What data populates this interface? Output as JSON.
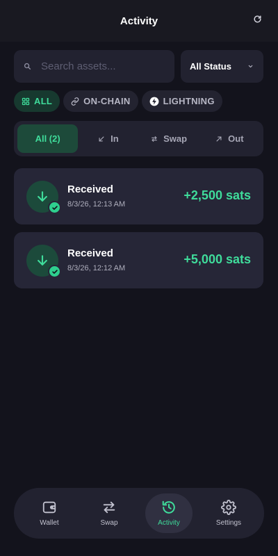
{
  "header": {
    "title": "Activity",
    "refresh_icon": "refresh-icon"
  },
  "search": {
    "placeholder": "Search assets...",
    "value": ""
  },
  "status_filter": {
    "selected": "All Status"
  },
  "network_filters": [
    {
      "label": "ALL",
      "icon": "grid-icon",
      "active": true
    },
    {
      "label": "ON-CHAIN",
      "icon": "link-icon",
      "active": false
    },
    {
      "label": "LIGHTNING",
      "icon": "lightning-icon",
      "active": false
    }
  ],
  "direction_tabs": [
    {
      "label": "All (2)",
      "active": true
    },
    {
      "label": "In",
      "icon": "arrow-down-left-icon",
      "active": false
    },
    {
      "label": "Swap",
      "icon": "swap-icon",
      "active": false
    },
    {
      "label": "Out",
      "icon": "arrow-up-right-icon",
      "active": false
    }
  ],
  "transactions": [
    {
      "title": "Received",
      "date": "8/3/26, 12:13 AM",
      "amount": "+2,500 sats",
      "status": "confirmed"
    },
    {
      "title": "Received",
      "date": "8/3/26, 12:12 AM",
      "amount": "+5,000 sats",
      "status": "confirmed"
    }
  ],
  "nav": [
    {
      "label": "Wallet",
      "icon": "wallet-icon",
      "active": false
    },
    {
      "label": "Swap",
      "icon": "swap-icon",
      "active": false
    },
    {
      "label": "Activity",
      "icon": "history-icon",
      "active": true
    },
    {
      "label": "Settings",
      "icon": "gear-icon",
      "active": false
    }
  ],
  "colors": {
    "background": "#13131c",
    "card": "#262637",
    "accent": "#3fdc9b",
    "accent_bg": "#1d4a3a"
  }
}
